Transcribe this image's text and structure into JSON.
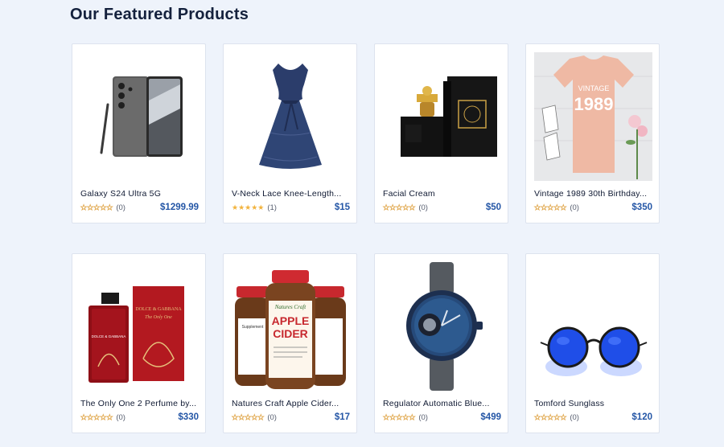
{
  "section": {
    "title": "Our Featured Products"
  },
  "products": [
    {
      "name": "Galaxy S24 Ultra 5G",
      "rating": 0,
      "reviews": "(0)",
      "price": "$1299.99",
      "image": "phone-image"
    },
    {
      "name": "V-Neck Lace Knee-Length...",
      "rating": 5,
      "reviews": "(1)",
      "price": "$15",
      "image": "dress-image"
    },
    {
      "name": "Facial Cream",
      "rating": 0,
      "reviews": "(0)",
      "price": "$50",
      "image": "cream-box-image"
    },
    {
      "name": "Vintage 1989 30th Birthday...",
      "rating": 0,
      "reviews": "(0)",
      "price": "$350",
      "image": "tshirt-image"
    },
    {
      "name": "The Only One 2 Perfume by...",
      "rating": 0,
      "reviews": "(0)",
      "price": "$330",
      "image": "perfume-image"
    },
    {
      "name": "Natures Craft Apple Cider...",
      "rating": 0,
      "reviews": "(0)",
      "price": "$17",
      "image": "supplement-bottles-image"
    },
    {
      "name": "Regulator Automatic Blue...",
      "rating": 0,
      "reviews": "(0)",
      "price": "$499",
      "image": "watch-image"
    },
    {
      "name": "Tomford Sunglass",
      "rating": 0,
      "reviews": "(0)",
      "price": "$120",
      "image": "sunglasses-image"
    }
  ],
  "image_text": {
    "tshirt_line1": "VINTAGE",
    "tshirt_line2": "1989",
    "perfume_brand": "DOLCE & GABBANA",
    "perfume_sub": "The Only One",
    "supp_brand": "Natures Craft",
    "supp_line1": "APPLE",
    "supp_line2": "CIDER",
    "supp_side": "Supplement"
  },
  "colors": {
    "accent_price": "#2456a6",
    "star_on": "#f2b33d",
    "background": "#eef3fb"
  }
}
